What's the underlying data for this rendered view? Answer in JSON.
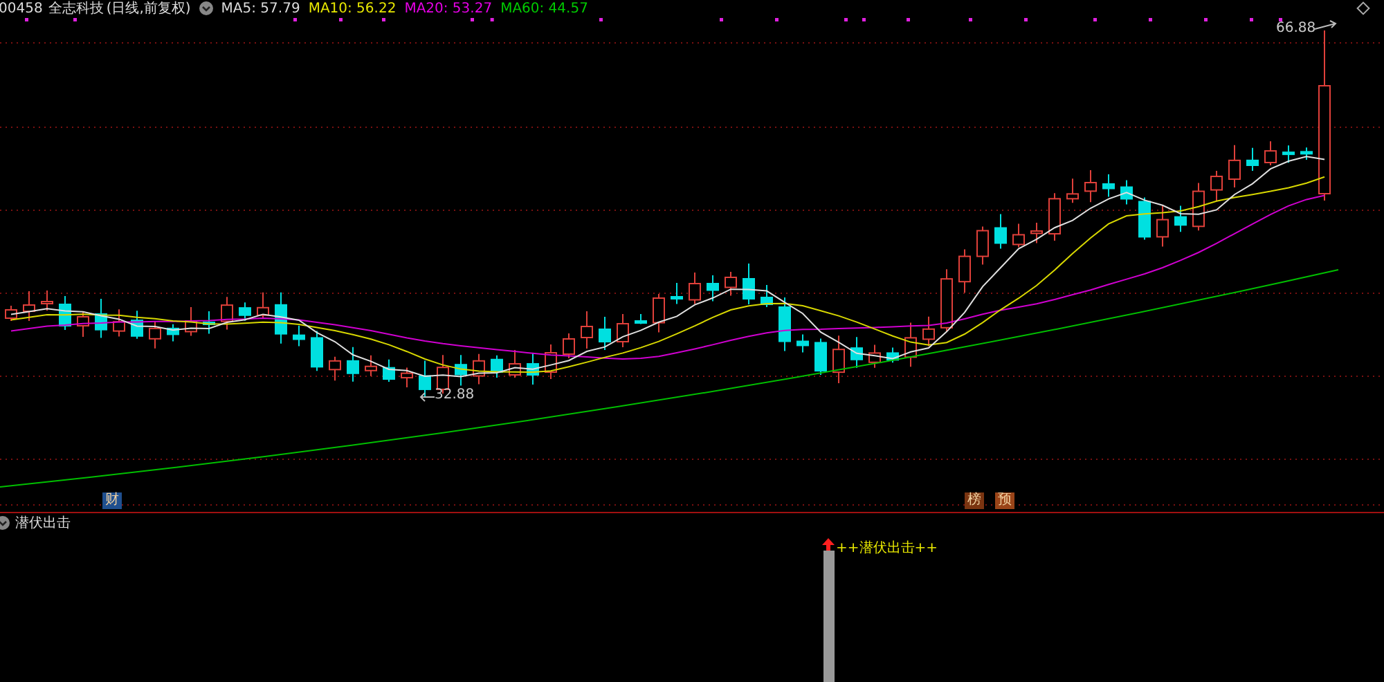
{
  "header": {
    "code": "00458",
    "name": "全志科技",
    "period": "(日线,前复权)",
    "ma": [
      {
        "label": "MA5: 57.79",
        "color": "#dcdcdc"
      },
      {
        "label": "MA10: 56.22",
        "color": "#e6e600"
      },
      {
        "label": "MA20: 53.27",
        "color": "#e600e6"
      },
      {
        "label": "MA60: 44.57",
        "color": "#00cc00"
      }
    ]
  },
  "chart": {
    "high_label": "66.88",
    "low_label": "32.88",
    "markers": [
      {
        "label": "财",
        "color": "#1f4f8f"
      },
      {
        "label": "榜",
        "color": "#7a3410"
      },
      {
        "label": "预",
        "color": "#9a4418"
      }
    ]
  },
  "indicator": {
    "title": "潜伏出击",
    "signal": "++潜伏出击++"
  }
}
